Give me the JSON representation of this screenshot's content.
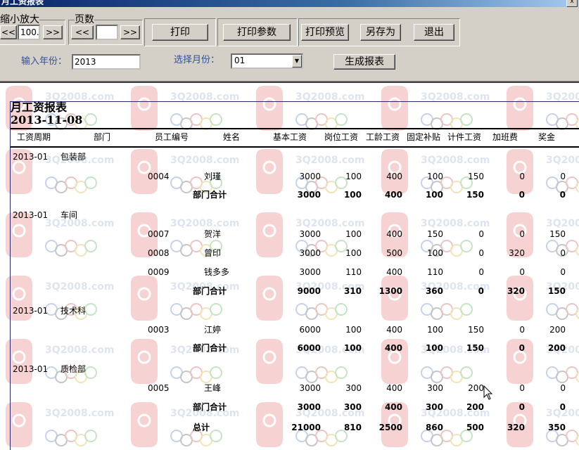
{
  "window": {
    "title": "月工资报表",
    "close_glyph": "x"
  },
  "toolbar": {
    "zoom_label": "缩小放大",
    "zoom_prev": "<<",
    "zoom_value": "100.",
    "zoom_next": ">>",
    "page_label": "页数",
    "page_prev": "<<",
    "page_value": "",
    "page_next": ">>",
    "print": "打印",
    "print_params": "打印参数",
    "print_preview": "打印预览",
    "save_as": "另存为",
    "exit": "退出"
  },
  "filters": {
    "year_label": "输入年份：",
    "year_value": "2013",
    "month_label": "选择月份：",
    "month_value": "01",
    "generate": "生成报表"
  },
  "watermark": {
    "text": "3Q2008.com"
  },
  "report": {
    "title": "月工资报表",
    "date": "2013-11-08",
    "columns": [
      "工资周期",
      "部门",
      "员工编号",
      "姓名",
      "基本工资",
      "岗位工资",
      "工龄工资",
      "固定补贴",
      "计件工资",
      "加班费",
      "奖金"
    ],
    "departments": [
      {
        "period": "2013-01",
        "dept": "包装部",
        "rows": [
          {
            "id": "0004",
            "name": "刘瑾",
            "values": [
              "3000",
              "100",
              "400",
              "100",
              "150",
              "0",
              "0"
            ]
          }
        ],
        "subtotal_label": "部门合计",
        "subtotal": [
          "3000",
          "100",
          "400",
          "100",
          "150",
          "0",
          "0"
        ]
      },
      {
        "period": "2013-01",
        "dept": "车间",
        "rows": [
          {
            "id": "0007",
            "name": "贺洋",
            "values": [
              "3000",
              "100",
              "400",
              "150",
              "0",
              "0",
              "150"
            ]
          },
          {
            "id": "0008",
            "name": "曾印",
            "values": [
              "3000",
              "100",
              "500",
              "100",
              "0",
              "320",
              "0"
            ]
          },
          {
            "id": "0009",
            "name": "钱多多",
            "values": [
              "3000",
              "110",
              "400",
              "110",
              "0",
              "0",
              "0"
            ]
          }
        ],
        "subtotal_label": "部门合计",
        "subtotal": [
          "9000",
          "310",
          "1300",
          "360",
          "0",
          "320",
          "150"
        ]
      },
      {
        "period": "2013-01",
        "dept": "技术科",
        "rows": [
          {
            "id": "0003",
            "name": "江婷",
            "values": [
              "6000",
              "100",
              "400",
              "100",
              "150",
              "0",
              "200"
            ]
          }
        ],
        "subtotal_label": "部门合计",
        "subtotal": [
          "6000",
          "100",
          "400",
          "100",
          "150",
          "0",
          "200"
        ]
      },
      {
        "period": "2013-01",
        "dept": "质检部",
        "rows": [
          {
            "id": "0005",
            "name": "王峰",
            "values": [
              "3000",
              "300",
              "400",
              "300",
              "200",
              "0",
              "0"
            ]
          }
        ],
        "subtotal_label": "部门合计",
        "subtotal": [
          "3000",
          "300",
          "400",
          "300",
          "200",
          "0",
          "0"
        ]
      }
    ],
    "total_label": "总计",
    "total": [
      "21000",
      "810",
      "2500",
      "860",
      "500",
      "320",
      "350"
    ]
  }
}
